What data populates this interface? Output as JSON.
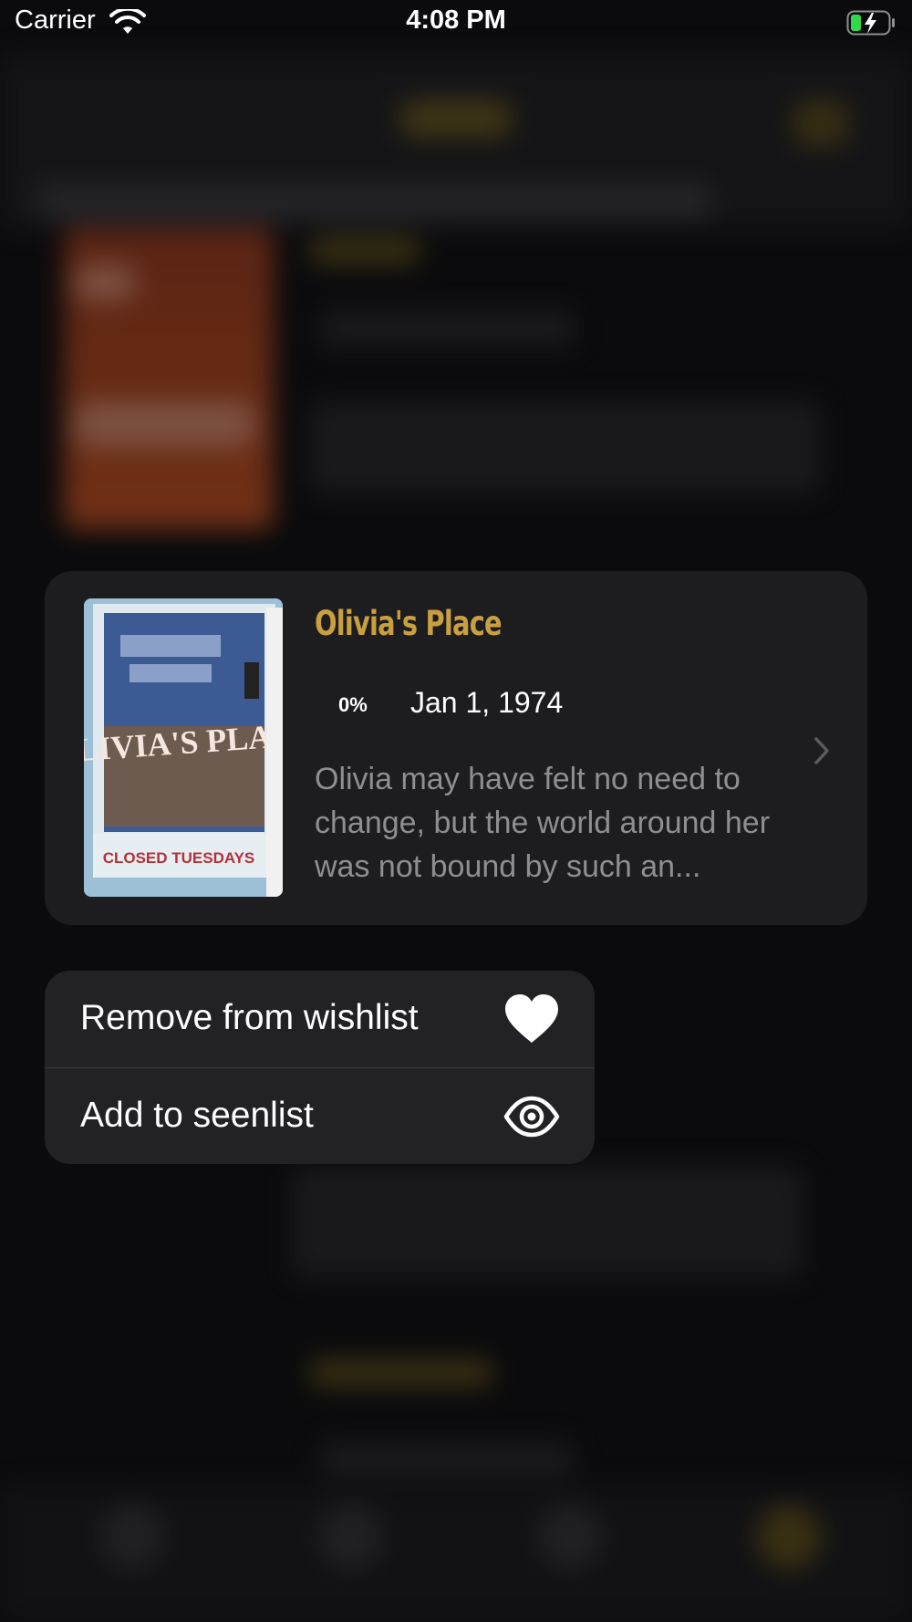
{
  "status_bar": {
    "carrier": "Carrier",
    "time": "4:08 PM"
  },
  "preview": {
    "title": "Olivia's Place",
    "score": "0%",
    "date": "Jan 1, 1974",
    "description": "Olivia may have felt no need to change, but the world around her was not bound by such an...",
    "poster": {
      "sign_text": "OLIVIA'S PLACE",
      "sub_text": "CLOSED TUESDAYS"
    }
  },
  "context_menu": {
    "items": [
      {
        "label": "Remove from wishlist",
        "icon": "heart-icon"
      },
      {
        "label": "Add to seenlist",
        "icon": "eye-icon"
      }
    ]
  },
  "colors": {
    "accent": "#c9a040",
    "card_bg": "#1d1d20",
    "menu_bg": "#222224"
  }
}
